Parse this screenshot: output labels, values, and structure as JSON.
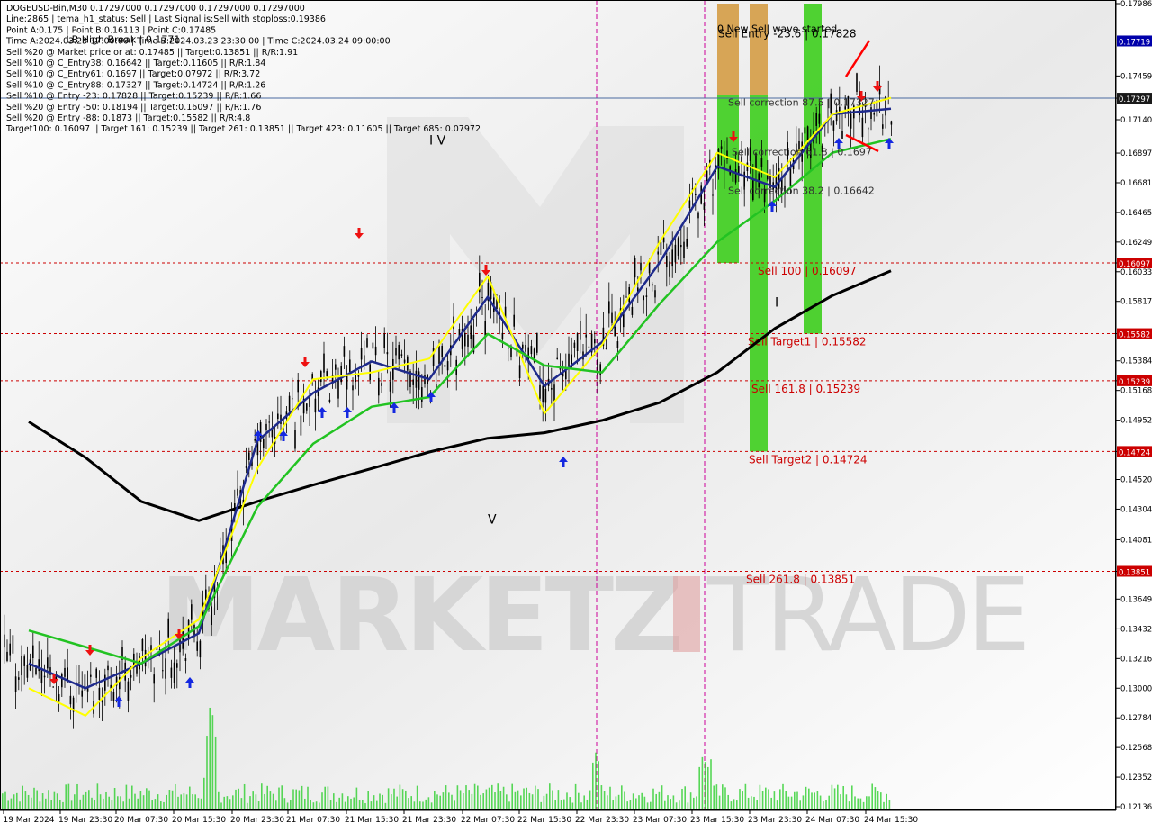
{
  "header": {
    "lines": [
      "DOGEUSD-Bin,M30  0.17297000 0.17297000 0.17297000 0.17297000",
      "Line:2865 | tema_h1_status: Sell | Last Signal is:Sell with stoploss:0.19386",
      "Point A:0.175 | Point B:0.16113 | Point C:0.17485",
      "Time A:2024.03.23 17:00:00 | Time B:2024.03.23 23:30:00 | Time C:2024.03.24 09:00:00",
      "Sell %20 @ Market price or at: 0.17485 || Target:0.13851 || R/R:1.91",
      "Sell %10 @ C_Entry38: 0.16642 || Target:0.11605 || R/R:1.84",
      "Sell %10 @ C_Entry61: 0.1697 || Target:0.07972 || R/R:3.72",
      "Sell %10 @ C_Entry88: 0.17327 || Target:0.14724 || R/R:1.26",
      "Sell %10 @ Entry -23: 0.17828 || Target:0.15239 || R/R:1.66",
      "Sell %20 @ Entry -50: 0.18194 || Target:0.16097 || R/R:1.76",
      "Sell %20 @ Entry -88: 0.1873 || Target:0.15582 || R/R:4.8",
      "Target100: 0.16097 || Target 161: 0.15239 || Target 261: 0.13851 || Target 423: 0.11605 || Target 685: 0.07972"
    ]
  },
  "chart_data": {
    "type": "line",
    "symbol": "DOGEUSD-Bin",
    "timeframe": "M30",
    "ylim": [
      0.12136,
      0.17986
    ],
    "y_ticks": [
      "0.17986",
      "0.17714",
      "0.17459",
      "0.17297",
      "0.17140",
      "0.16897",
      "0.16681",
      "0.16465",
      "0.16249",
      "0.16097",
      "0.16033",
      "0.15817",
      "0.15582",
      "0.15384",
      "0.15239",
      "0.15168",
      "0.14952",
      "0.14724",
      "0.14520",
      "0.14304",
      "0.14081",
      "0.13851",
      "0.13649",
      "0.13432",
      "0.13216",
      "0.13000",
      "0.12784",
      "0.12568",
      "0.12352",
      "0.12136"
    ],
    "x_ticks": [
      "19 Mar 2024",
      "19 Mar 23:30",
      "20 Mar 07:30",
      "20 Mar 15:30",
      "20 Mar 23:30",
      "21 Mar 07:30",
      "21 Mar 15:30",
      "21 Mar 23:30",
      "22 Mar 07:30",
      "22 Mar 15:30",
      "22 Mar 23:30",
      "23 Mar 07:30",
      "23 Mar 15:30",
      "23 Mar 23:30",
      "24 Mar 07:30",
      "24 Mar 15:30"
    ],
    "levels": [
      {
        "label": "Sell Entry -23.6 | 0.17828",
        "value": 0.17714,
        "axis_label": "0.17719",
        "color": "#0000aa",
        "style": "dash"
      },
      {
        "label": "",
        "value": 0.17297,
        "axis_label": "0.17297",
        "color": "#4a6aa0",
        "style": "solid"
      },
      {
        "label": "Sell 100 | 0.16097",
        "value": 0.16097,
        "axis_label": "0.16097",
        "color": "#cc0000",
        "style": "dot"
      },
      {
        "label": "Sell Target1 | 0.15582",
        "value": 0.15582,
        "axis_label": "0.15582",
        "color": "#cc0000",
        "style": "dot"
      },
      {
        "label": "Sell 161.8 | 0.15239",
        "value": 0.15239,
        "axis_label": "0.15239",
        "color": "#cc0000",
        "style": "dot"
      },
      {
        "label": "Sell Target2 | 0.14724",
        "value": 0.14724,
        "axis_label": "0.14724",
        "color": "#cc0000",
        "style": "dot"
      },
      {
        "label": "Sell 261.8 | 0.13851",
        "value": 0.13851,
        "axis_label": "0.13851",
        "color": "#cc0000",
        "style": "dot"
      }
    ],
    "annotations": [
      {
        "text": "0 New Sell wave started",
        "x": "23 Mar 15:30",
        "y": 0.1778,
        "color": "#000000"
      },
      {
        "text": "Sell correction 87.5 | 0.17327",
        "x": "23 Mar 17:00",
        "y": 0.1724,
        "color": "#333333"
      },
      {
        "text": "Sell correction 61.8 | 0.1697",
        "x": "23 Mar 17:30",
        "y": 0.1688,
        "color": "#333333"
      },
      {
        "text": "Sell correction 38.2 | 0.16642",
        "x": "23 Mar 17:00",
        "y": 0.166,
        "color": "#333333"
      },
      {
        "text": "LB High Break | 0.1771",
        "x": "19 Mar 15:30",
        "y": 0.177,
        "color": "#000000"
      },
      {
        "text": "I V",
        "x": "21 Mar 23:30",
        "y": 0.1696,
        "color": "#000000"
      },
      {
        "text": "V",
        "x": "22 Mar 07:30",
        "y": 0.142,
        "color": "#000000"
      },
      {
        "text": "I",
        "x": "23 Mar 23:30",
        "y": 0.1578,
        "color": "#000000"
      }
    ],
    "series": [
      {
        "name": "",
        "color": "#000000",
        "x": [
          "19 Mar 2024",
          "19 Mar 23:30",
          "20 Mar 07:30",
          "20 Mar 15:30",
          "20 Mar 23:30",
          "21 Mar 07:30",
          "21 Mar 15:30",
          "21 Mar 23:30",
          "22 Mar 07:30",
          "22 Mar 15:30",
          "22 Mar 23:30",
          "23 Mar 07:30",
          "23 Mar 15:30",
          "23 Mar 23:30",
          "24 Mar 07:30",
          "24 Mar 15:30"
        ],
        "values": [
          0.1494,
          0.1468,
          0.1436,
          0.1422,
          0.1436,
          0.1448,
          0.146,
          0.1472,
          0.1482,
          0.1486,
          0.1495,
          0.1508,
          0.153,
          0.1562,
          0.1586,
          0.1604
        ]
      },
      {
        "name": "",
        "color": "#1e2a8c",
        "x": [
          "19 Mar 2024",
          "19 Mar 23:30",
          "20 Mar 07:30",
          "20 Mar 15:30",
          "20 Mar 23:30",
          "21 Mar 07:30",
          "21 Mar 15:30",
          "21 Mar 23:30",
          "22 Mar 07:30",
          "22 Mar 15:30",
          "22 Mar 23:30",
          "23 Mar 07:30",
          "23 Mar 15:30",
          "23 Mar 23:30",
          "24 Mar 07:30",
          "24 Mar 15:30"
        ],
        "values": [
          0.1318,
          0.13,
          0.1318,
          0.134,
          0.148,
          0.1515,
          0.1538,
          0.1525,
          0.1585,
          0.152,
          0.1552,
          0.161,
          0.168,
          0.1665,
          0.1718,
          0.1722
        ]
      },
      {
        "name": "",
        "color": "#ffff00",
        "x": [
          "19 Mar 2024",
          "19 Mar 23:30",
          "20 Mar 07:30",
          "20 Mar 15:30",
          "20 Mar 23:30",
          "21 Mar 07:30",
          "21 Mar 15:30",
          "21 Mar 23:30",
          "22 Mar 07:30",
          "22 Mar 15:30",
          "22 Mar 23:30",
          "23 Mar 07:30",
          "23 Mar 15:30",
          "23 Mar 23:30",
          "24 Mar 07:30",
          "24 Mar 15:30"
        ],
        "values": [
          0.13,
          0.128,
          0.1322,
          0.135,
          0.146,
          0.1525,
          0.153,
          0.154,
          0.16,
          0.15,
          0.155,
          0.1625,
          0.169,
          0.1672,
          0.1718,
          0.173
        ]
      },
      {
        "name": "",
        "color": "#22c322",
        "x": [
          "19 Mar 2024",
          "19 Mar 23:30",
          "20 Mar 07:30",
          "20 Mar 15:30",
          "20 Mar 23:30",
          "21 Mar 07:30",
          "21 Mar 15:30",
          "21 Mar 23:30",
          "22 Mar 07:30",
          "22 Mar 15:30",
          "22 Mar 23:30",
          "23 Mar 07:30",
          "23 Mar 15:30",
          "23 Mar 23:30",
          "24 Mar 07:30",
          "24 Mar 15:30"
        ],
        "values": [
          0.1342,
          0.133,
          0.1318,
          0.1345,
          0.1432,
          0.1478,
          0.1505,
          0.1512,
          0.1558,
          0.1535,
          0.153,
          0.158,
          0.1625,
          0.1655,
          0.169,
          0.17
        ]
      }
    ],
    "zones": [
      {
        "x0": "23 Mar 15:30",
        "x1": "23 Mar 18:30",
        "top": 0.17986,
        "bottom": 0.16097,
        "color": "#33cc11"
      },
      {
        "x0": "23 Mar 20:00",
        "x1": "23 Mar 22:30",
        "top": 0.17986,
        "bottom": 0.14724,
        "color": "#33cc11"
      },
      {
        "x0": "24 Mar 03:30",
        "x1": "24 Mar 06:00",
        "top": 0.17986,
        "bottom": 0.15582,
        "color": "#33cc11"
      }
    ],
    "current_price": "0.17297",
    "grid": false
  },
  "colors": {
    "background": "#ffffff",
    "level_red": "#cc0000",
    "axis_label_bg": "#cc0000",
    "vline": "#cc0099",
    "volume": "#22cc22",
    "watermark": "#d9d9d9"
  },
  "watermark": {
    "left": "MARKETZ",
    "right": "TRADE"
  }
}
